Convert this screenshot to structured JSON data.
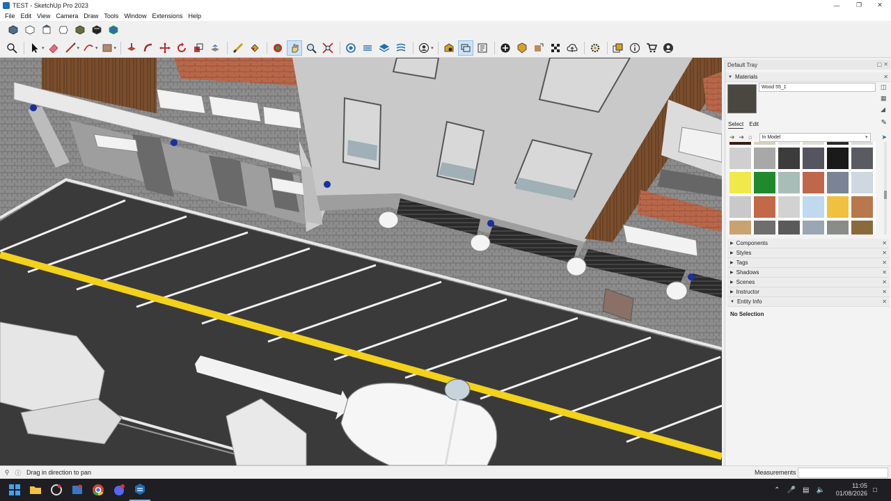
{
  "window": {
    "title": "TEST - SketchUp Pro 2023",
    "controls": [
      "minimize",
      "maximize",
      "close"
    ]
  },
  "menu": [
    "File",
    "Edit",
    "View",
    "Camera",
    "Draw",
    "Tools",
    "Window",
    "Extensions",
    "Help"
  ],
  "toolbar_views": [
    "iso-view-icon",
    "top-view-icon",
    "front-view-icon",
    "right-view-icon",
    "back-view-icon",
    "left-view-icon",
    "bottom-view-icon"
  ],
  "toolbar_main": [
    "search-icon",
    "select-icon",
    "eraser-icon",
    "line-icon",
    "arc-icon",
    "rectangle-icon",
    "push-pull-icon",
    "follow-me-icon",
    "move-icon",
    "rotate-icon",
    "scale-icon",
    "offset-icon",
    "tape-measure-icon",
    "paint-bucket-icon",
    "orbit-icon",
    "pan-icon",
    "zoom-icon",
    "zoom-extents-icon",
    "section-plane-icon",
    "component-icon",
    "layers-icon",
    "styles-icon",
    "account-icon",
    "3d-warehouse-icon",
    "extension-warehouse-icon",
    "outliner-icon",
    "add-location-icon",
    "trimble-connect-icon",
    "sandbox-icon",
    "cloud-icon",
    "settings-icon",
    "dynamic-component-icon",
    "info-icon",
    "cart-icon",
    "profile-icon"
  ],
  "tray": {
    "title": "Default Tray",
    "materials": {
      "header": "Materials",
      "current_name": "Wood 55_1",
      "tab_select": "Select",
      "tab_edit": "Edit",
      "collection": "In Model",
      "swatch_colors": [
        "#3a1a14",
        "#d8d0c0",
        "#e8e8e8",
        "#e0ddd2",
        "#2a2a2a",
        "#dcdcdc",
        "#cfcfcf",
        "#a8a8a8",
        "#3c3c3c",
        "#555560",
        "#1a1a1a",
        "#5a5a62",
        "#f1e84a",
        "#1f8a2b",
        "#a9bdb8",
        "#c0664a",
        "#7a8494",
        "#cfd8e0",
        "#c9c9c9",
        "#c26a48",
        "#d2d2d2",
        "#bfd9ee",
        "#f0c040",
        "#b8774d",
        "#c9a270",
        "#6e6e6e",
        "#5a5a5a",
        "#9aa6b2",
        "#8a8c88",
        "#8a6a3a"
      ]
    },
    "panels": [
      "Components",
      "Styles",
      "Tags",
      "Shadows",
      "Scenes",
      "Instructor"
    ],
    "entity_info": {
      "header": "Entity Info",
      "body": "No Selection"
    }
  },
  "status": {
    "message": "Drag in direction to pan",
    "measurements_label": "Measurements",
    "measurements_value": ""
  },
  "taskbar": {
    "apps": [
      "windows-start-icon",
      "file-explorer-icon",
      "remote-app-icon",
      "browser-icon",
      "chrome-icon",
      "messaging-icon",
      "sketchup-icon"
    ],
    "time": "11:05",
    "date": "01/08/2026"
  }
}
